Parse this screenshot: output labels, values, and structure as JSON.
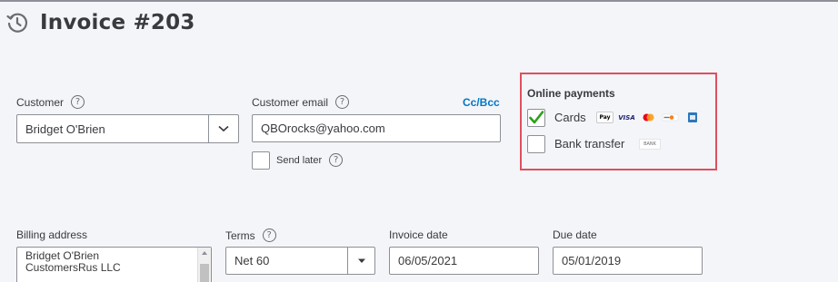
{
  "header": {
    "title": "Invoice #203",
    "icon": "history-icon"
  },
  "customer": {
    "label": "Customer",
    "value": "Bridget O'Brien"
  },
  "customer_email": {
    "label": "Customer email",
    "value": "QBOrocks@yahoo.com",
    "cc_bcc": "Cc/Bcc",
    "send_later": "Send later",
    "send_later_checked": false
  },
  "online_payments": {
    "title": "Online payments",
    "cards": {
      "label": "Cards",
      "checked": true,
      "icons": [
        "apple-pay-icon",
        "visa-icon",
        "mastercard-icon",
        "discover-icon",
        "amex-icon"
      ]
    },
    "bank": {
      "label": "Bank transfer",
      "checked": false,
      "icon_text": "BANK"
    }
  },
  "billing": {
    "label": "Billing address",
    "lines": [
      "Bridget O'Brien",
      "CustomersRus LLC"
    ]
  },
  "terms": {
    "label": "Terms",
    "value": "Net 60"
  },
  "invoice_date": {
    "label": "Invoice date",
    "value": "06/05/2021"
  },
  "due_date": {
    "label": "Due date",
    "value": "05/01/2019"
  },
  "help_glyph": "?",
  "colors": {
    "accent_link": "#0077c5",
    "check_green": "#2ca01c",
    "highlight_border": "#e04f5f"
  }
}
